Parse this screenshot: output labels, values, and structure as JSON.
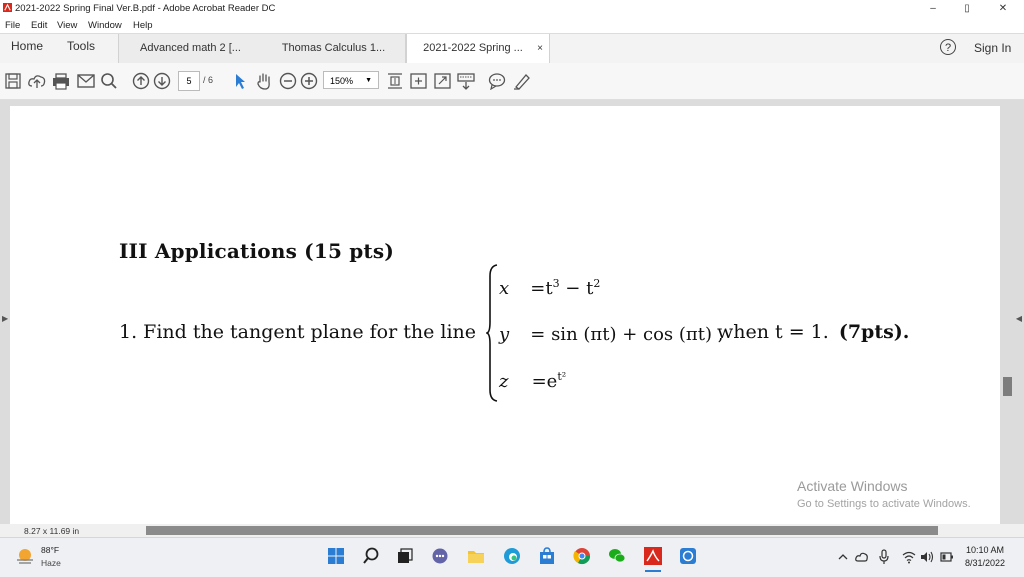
{
  "window": {
    "title": "2021-2022 Spring Final Ver.B.pdf - Adobe Acrobat Reader DC",
    "minimize": "–",
    "maximize": "▯",
    "close": "✕"
  },
  "menu": [
    "File",
    "Edit",
    "View",
    "Window",
    "Help"
  ],
  "nav": {
    "home": "Home",
    "tools": "Tools"
  },
  "tabs": [
    {
      "label": "Advanced math 2 [...",
      "active": false
    },
    {
      "label": "Thomas Calculus 1...",
      "active": false
    },
    {
      "label": "2021-2022 Spring ...",
      "active": true,
      "close": "×"
    }
  ],
  "header": {
    "help": "?",
    "sign_in": "Sign In"
  },
  "toolbar": {
    "page_current": "5",
    "page_total": "/ 6",
    "zoom": "150%",
    "zoom_caret": "▼"
  },
  "document": {
    "heading": "III Applications (15 pts)",
    "problem_prefix": "1. Find the tangent plane for the line",
    "eq_x_var": "x",
    "eq_x_rhs": "=t",
    "eq_x_exp1": "3",
    "eq_x_mid": " − t",
    "eq_x_exp2": "2",
    "eq_y_var": "y",
    "eq_y_rhs": "= sin (πt) + cos (πt) ,",
    "eq_z_var": "z",
    "eq_z_rhs": "=e",
    "eq_z_exp": "t²",
    "problem_suffix": "when t = 1.",
    "points": "(7pts)."
  },
  "watermark": {
    "line1": "Activate Windows",
    "line2": "Go to Settings to activate Windows."
  },
  "status": {
    "page_size": "8.27 x 11.69 in"
  },
  "taskbar": {
    "weather_temp": "88°F",
    "weather_desc": "Haze",
    "time": "10:10 AM",
    "date": "8/31/2022"
  },
  "icons": {
    "accent": "#2b7cd3",
    "acrobat_red": "#d9291c"
  }
}
